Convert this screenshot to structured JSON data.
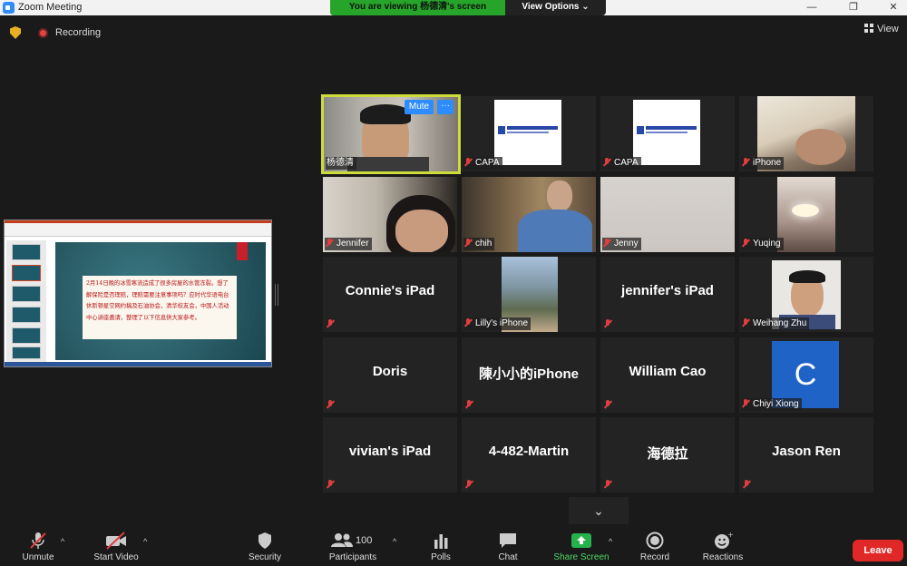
{
  "window": {
    "title": "Zoom Meeting"
  },
  "banner": {
    "viewing": "You are viewing 杨德清's screen",
    "view_options": "View Options ⌄"
  },
  "window_controls": {
    "minimize": "—",
    "maximize": "❐",
    "close": "✕"
  },
  "recording": {
    "label": "Recording"
  },
  "view_button": {
    "label": "View"
  },
  "slide": {
    "text": "2月14日晚的冰雪寒流造成了很多房屋的水管冻裂。想了解保险是否理赔，理赔需要注意事项吗？应时代华语电台休斯顿星空网约稿及石油协会，清华校友会，中国人活动中心讲座邀请，整理了以下信息供大家参考。"
  },
  "active_speaker": {
    "mute_label": "Mute",
    "more_label": "···"
  },
  "tiles": [
    {
      "name": "杨德清"
    },
    {
      "name": "CAPA"
    },
    {
      "name": "CAPA"
    },
    {
      "name": "iPhone"
    },
    {
      "name": "Jennifer"
    },
    {
      "name": "chih"
    },
    {
      "name": "Jenny"
    },
    {
      "name": "Yuqing"
    },
    {
      "name": "Connie's iPad"
    },
    {
      "name": "Lilly's iPhone"
    },
    {
      "name": "jennifer's iPad"
    },
    {
      "name": "Weihang Zhu"
    },
    {
      "name": "Doris"
    },
    {
      "name": "陳小小的iPhone"
    },
    {
      "name": "William Cao"
    },
    {
      "name": "Chiyi Xiong",
      "avatar_letter": "C"
    },
    {
      "name": "vivian's iPad"
    },
    {
      "name": "4-482-Martin"
    },
    {
      "name": "海德拉"
    },
    {
      "name": "Jason Ren"
    }
  ],
  "toolbar": {
    "unmute": "Unmute",
    "start_video": "Start Video",
    "security": "Security",
    "participants": "Participants",
    "participants_count": "100",
    "polls": "Polls",
    "chat": "Chat",
    "share_screen": "Share Screen",
    "record": "Record",
    "reactions": "Reactions",
    "leave": "Leave",
    "scroll_more": "⌄",
    "caret": "^"
  },
  "colors": {
    "brand_blue": "#2d8cff",
    "banner_green": "#26a52a",
    "leave_red": "#e02828",
    "muted_red": "#e03e3e"
  }
}
